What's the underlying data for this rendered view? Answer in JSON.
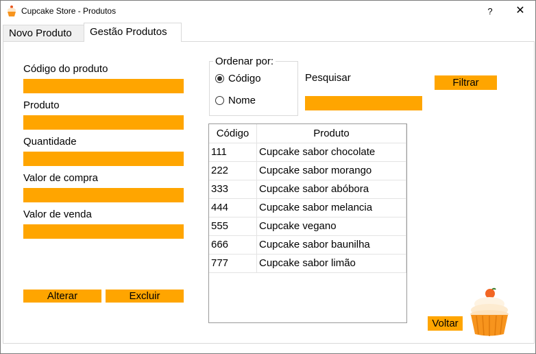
{
  "window": {
    "title": "Cupcake Store - Produtos",
    "help_label": "?",
    "close_label": "✕"
  },
  "tabs": [
    {
      "label": "Novo Produto",
      "active": false
    },
    {
      "label": "Gestão Produtos",
      "active": true
    }
  ],
  "form": {
    "codigo_label": "Código do produto",
    "produto_label": "Produto",
    "quantidade_label": "Quantidade",
    "valor_compra_label": "Valor de compra",
    "valor_venda_label": "Valor de venda",
    "codigo_value": "",
    "produto_value": "",
    "quantidade_value": "",
    "valor_compra_value": "",
    "valor_venda_value": "",
    "alterar_label": "Alterar",
    "excluir_label": "Excluir"
  },
  "order": {
    "title": "Ordenar por:",
    "options": [
      "Código",
      "Nome"
    ],
    "selected": "Código"
  },
  "search": {
    "label": "Pesquisar",
    "value": "",
    "filter_label": "Filtrar"
  },
  "table": {
    "headers": [
      "Código",
      "Produto"
    ],
    "rows": [
      [
        "111",
        "Cupcake sabor chocolate"
      ],
      [
        "222",
        "Cupcake sabor morango"
      ],
      [
        "333",
        "Cupcake sabor abóbora"
      ],
      [
        "444",
        "Cupcake sabor melancia"
      ],
      [
        "555",
        "Cupcake vegano"
      ],
      [
        "666",
        "Cupcake sabor baunilha"
      ],
      [
        "777",
        "Cupcake sabor limão"
      ]
    ]
  },
  "footer": {
    "voltar_label": "Voltar"
  },
  "colors": {
    "accent": "#ffa500",
    "border": "#d9d9d9"
  },
  "icons": {
    "app": "cupcake-icon",
    "decoration": "cupcake-icon"
  }
}
